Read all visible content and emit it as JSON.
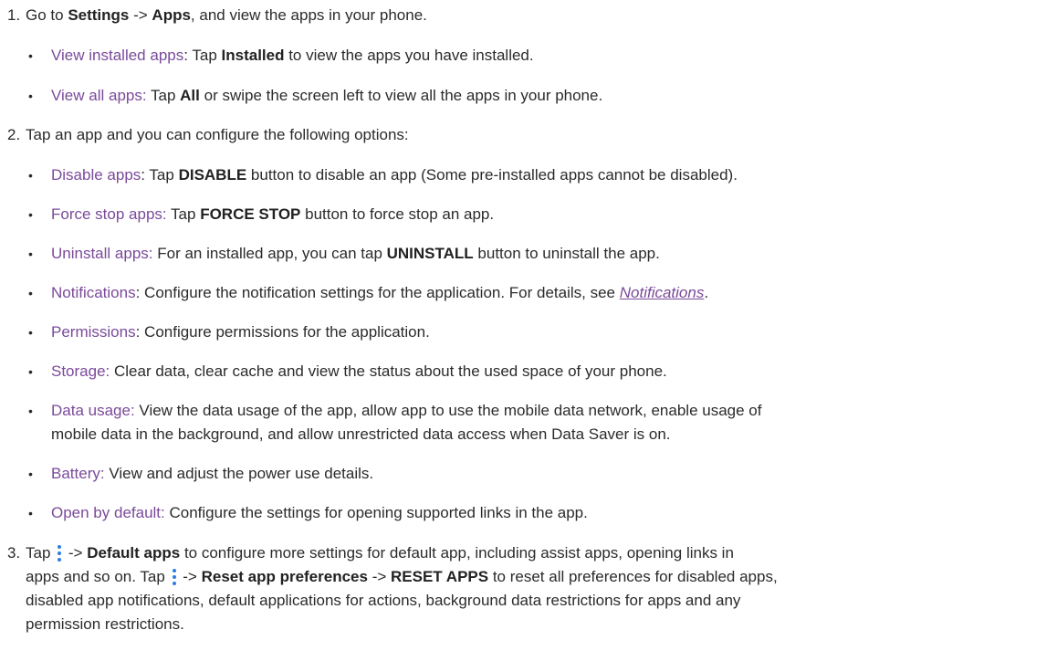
{
  "steps": [
    {
      "num": "1.",
      "parts": [
        "Go to ",
        "Settings",
        " -> ",
        "Apps",
        ", and view the apps in your phone."
      ],
      "items": [
        {
          "term": "View installed apps",
          "text1": ": Tap ",
          "bold": "Installed",
          "text2": " to view the apps you have installed."
        },
        {
          "term": "View all apps:",
          "text1": " Tap ",
          "bold": "All",
          "text2": " or swipe the screen left to view all the apps in your phone."
        }
      ]
    },
    {
      "num": "2.",
      "text": "Tap an app and you can configure the following options:",
      "items": [
        {
          "term": "Disable apps",
          "text1": ": Tap ",
          "bold": "DISABLE",
          "text2": " button to disable an app (Some pre-installed apps cannot be disabled)."
        },
        {
          "term": "Force stop apps:",
          "text1": " Tap ",
          "bold": "FORCE STOP",
          "text2": " button to force stop an app."
        },
        {
          "term": "Uninstall apps:",
          "text1": " For an installed app, you can tap ",
          "bold": "UNINSTALL",
          "text2": " button to uninstall the app."
        },
        {
          "term": "Notifications",
          "text1": ": Configure the notification settings for the application. For details, see ",
          "link": "Notifications",
          "text2": "."
        },
        {
          "term": "Permissions",
          "text1": ": Configure permissions for the application."
        },
        {
          "term": "Storage:",
          "text1": " Clear data, clear cache and view the status about the used space of your phone."
        },
        {
          "term": "Data usage:",
          "text1": " View the data usage of the app, allow app to use the mobile data network, enable usage of",
          "line2": "mobile data in the background, and allow unrestricted data access when Data Saver is on."
        },
        {
          "term": "Battery:",
          "text1": " View and adjust the power use details."
        },
        {
          "term": "Open by default:",
          "text1": " Configure the settings for opening supported links in the app."
        }
      ]
    },
    {
      "num": "3.",
      "a1": "Tap ",
      "a2": " -> ",
      "a3": "Default apps",
      "a4": " to configure more settings for default app, including assist apps, opening links in",
      "b1": "apps and so on. Tap ",
      "b2": " -> ",
      "b3": "Reset app preferences",
      "b4": " -> ",
      "b5": "RESET APPS",
      "b6": " to reset all preferences for disabled apps,",
      "c": "disabled app notifications, default applications for actions, background data restrictions for apps and any",
      "d": "permission restrictions."
    }
  ],
  "bullet_char": "•",
  "icon_color": "#2e7de0",
  "accent_color": "#7a4a9a"
}
